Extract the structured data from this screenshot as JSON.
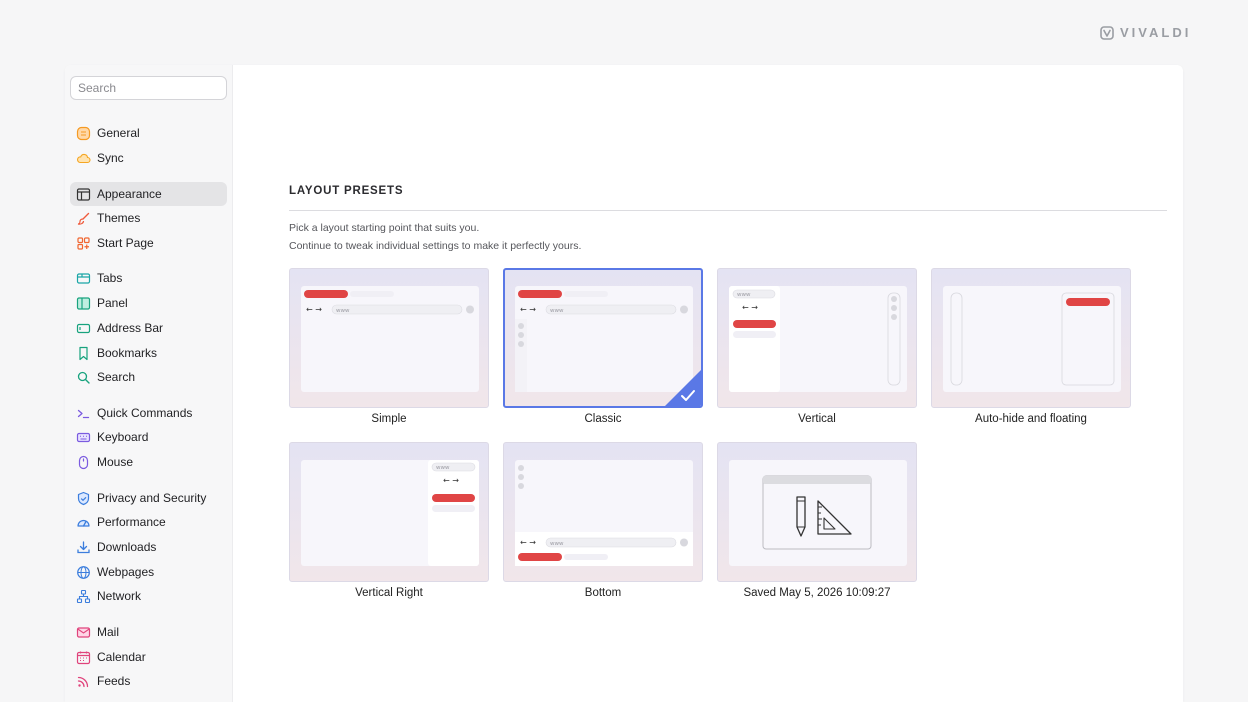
{
  "brand": {
    "name": "VIVALDI"
  },
  "search": {
    "placeholder": "Search"
  },
  "sidebar": {
    "items": [
      {
        "label": "General",
        "icon": "general-icon"
      },
      {
        "label": "Sync",
        "icon": "cloud-icon"
      },
      {
        "label": "Appearance",
        "icon": "appearance-icon",
        "active": true
      },
      {
        "label": "Themes",
        "icon": "brush-icon"
      },
      {
        "label": "Start Page",
        "icon": "start-page-icon"
      },
      {
        "label": "Tabs",
        "icon": "tabs-icon"
      },
      {
        "label": "Panel",
        "icon": "panel-icon"
      },
      {
        "label": "Address Bar",
        "icon": "address-bar-icon"
      },
      {
        "label": "Bookmarks",
        "icon": "bookmark-icon"
      },
      {
        "label": "Search",
        "icon": "search-icon"
      },
      {
        "label": "Quick Commands",
        "icon": "quick-commands-icon"
      },
      {
        "label": "Keyboard",
        "icon": "keyboard-icon"
      },
      {
        "label": "Mouse",
        "icon": "mouse-icon"
      },
      {
        "label": "Privacy and Security",
        "icon": "shield-icon"
      },
      {
        "label": "Performance",
        "icon": "gauge-icon"
      },
      {
        "label": "Downloads",
        "icon": "download-icon"
      },
      {
        "label": "Webpages",
        "icon": "globe-icon"
      },
      {
        "label": "Network",
        "icon": "network-icon"
      },
      {
        "label": "Mail",
        "icon": "mail-icon"
      },
      {
        "label": "Calendar",
        "icon": "calendar-icon"
      },
      {
        "label": "Feeds",
        "icon": "feed-icon"
      }
    ]
  },
  "main": {
    "section_title": "LAYOUT PRESETS",
    "desc_line1": "Pick a layout starting point that suits you.",
    "desc_line2": "Continue to tweak individual settings to make it perfectly yours.",
    "presets": [
      {
        "label": "Simple",
        "selected": false,
        "address_text": "www"
      },
      {
        "label": "Classic",
        "selected": true,
        "address_text": "www"
      },
      {
        "label": "Vertical",
        "selected": false,
        "address_text": "www"
      },
      {
        "label": "Auto-hide and floating",
        "selected": false
      },
      {
        "label": "Vertical Right",
        "selected": false,
        "address_text": "www"
      },
      {
        "label": "Bottom",
        "selected": false,
        "address_text": "www"
      },
      {
        "label": "Saved May 5, 2026 10:09:27",
        "selected": false
      }
    ]
  },
  "colors": {
    "accent": "#5a78e6",
    "tab_red": "#e04545"
  }
}
